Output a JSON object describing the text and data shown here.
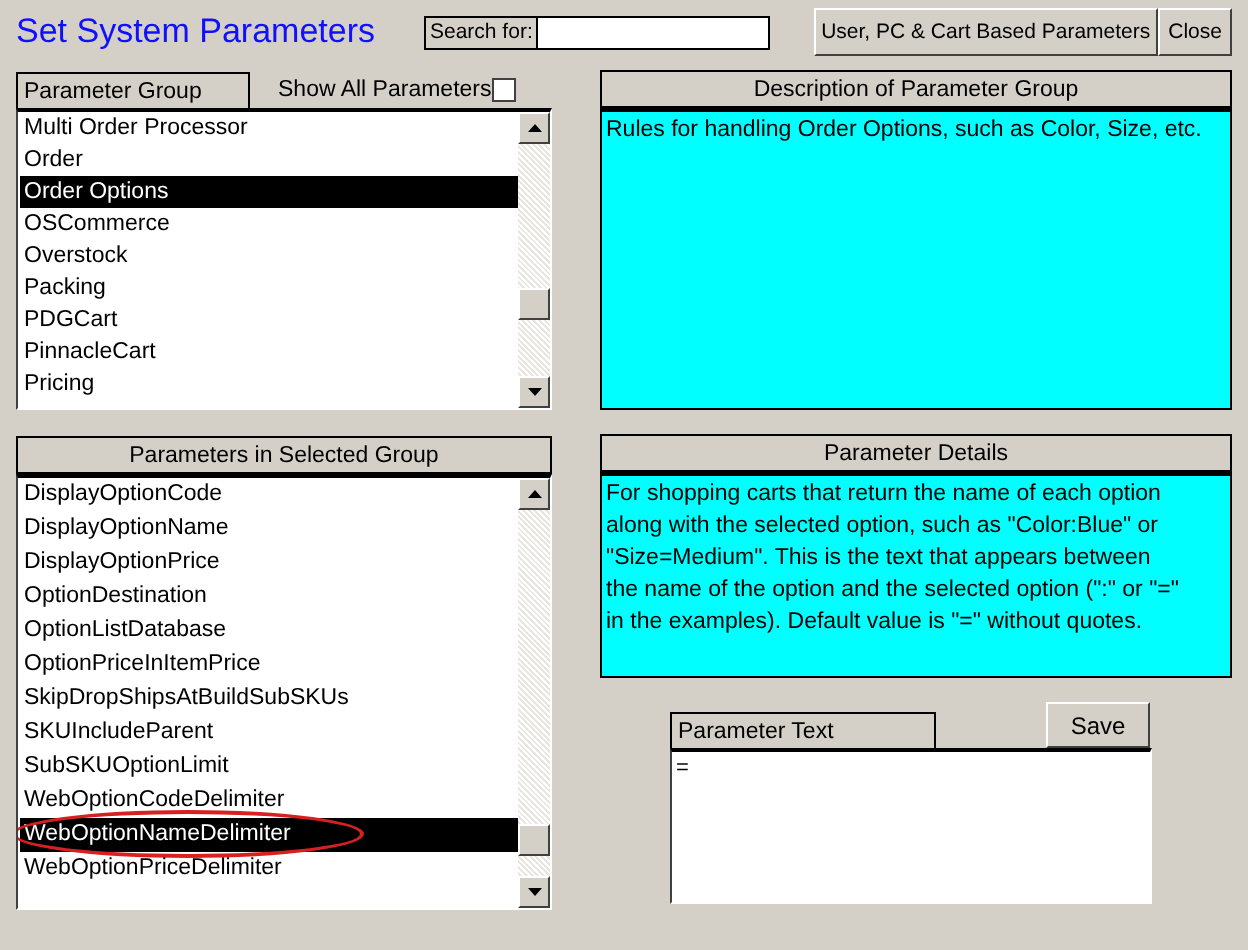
{
  "title": "Set System Parameters",
  "search": {
    "label": "Search for:"
  },
  "buttons": [
    {
      "label": "User, PC & Cart Based Parameters"
    },
    {
      "label": "Close"
    }
  ],
  "group_panel": {
    "heading": "Parameter Group",
    "show_all": {
      "label": "Show All Parameters",
      "checked": false
    },
    "items": [
      {
        "label": "Multi Order Processor",
        "selected": false
      },
      {
        "label": "Order",
        "selected": false
      },
      {
        "label": "Order Options",
        "selected": true
      },
      {
        "label": "OSCommerce",
        "selected": false
      },
      {
        "label": "Overstock",
        "selected": false
      },
      {
        "label": "Packing",
        "selected": false
      },
      {
        "label": "PDGCart",
        "selected": false
      },
      {
        "label": "PinnacleCart",
        "selected": false
      },
      {
        "label": "Pricing",
        "selected": false
      }
    ]
  },
  "description": {
    "heading": "Description of Parameter Group",
    "text": "Rules for handling Order Options, such as Color, Size, etc."
  },
  "params_panel": {
    "heading": "Parameters in Selected Group",
    "items": [
      {
        "label": "DisplayOptionCode",
        "selected": false,
        "circled": false
      },
      {
        "label": "DisplayOptionName",
        "selected": false,
        "circled": false
      },
      {
        "label": "DisplayOptionPrice",
        "selected": false,
        "circled": false
      },
      {
        "label": "OptionDestination",
        "selected": false,
        "circled": false
      },
      {
        "label": "OptionListDatabase",
        "selected": false,
        "circled": false
      },
      {
        "label": "OptionPriceInItemPrice",
        "selected": false,
        "circled": false
      },
      {
        "label": "SkipDropShipsAtBuildSubSKUs",
        "selected": false,
        "circled": false
      },
      {
        "label": "SKUIncludeParent",
        "selected": false,
        "circled": false
      },
      {
        "label": "SubSKUOptionLimit",
        "selected": false,
        "circled": false
      },
      {
        "label": "WebOptionCodeDelimiter",
        "selected": false,
        "circled": false
      },
      {
        "label": "WebOptionNameDelimiter",
        "selected": true,
        "circled": true
      },
      {
        "label": "WebOptionPriceDelimiter",
        "selected": false,
        "circled": false
      }
    ]
  },
  "details": {
    "heading": "Parameter Details",
    "text": "For shopping carts that return the name of each option along with the selected option, such as \"Color:Blue\" or \"Size=Medium\". This is the text that appears between the name of the option and the selected option (\":\" or \"=\" in the examples). Default value is \"=\" without quotes."
  },
  "parameter_text": {
    "label": "Parameter Text",
    "value": "=",
    "save": "Save"
  }
}
